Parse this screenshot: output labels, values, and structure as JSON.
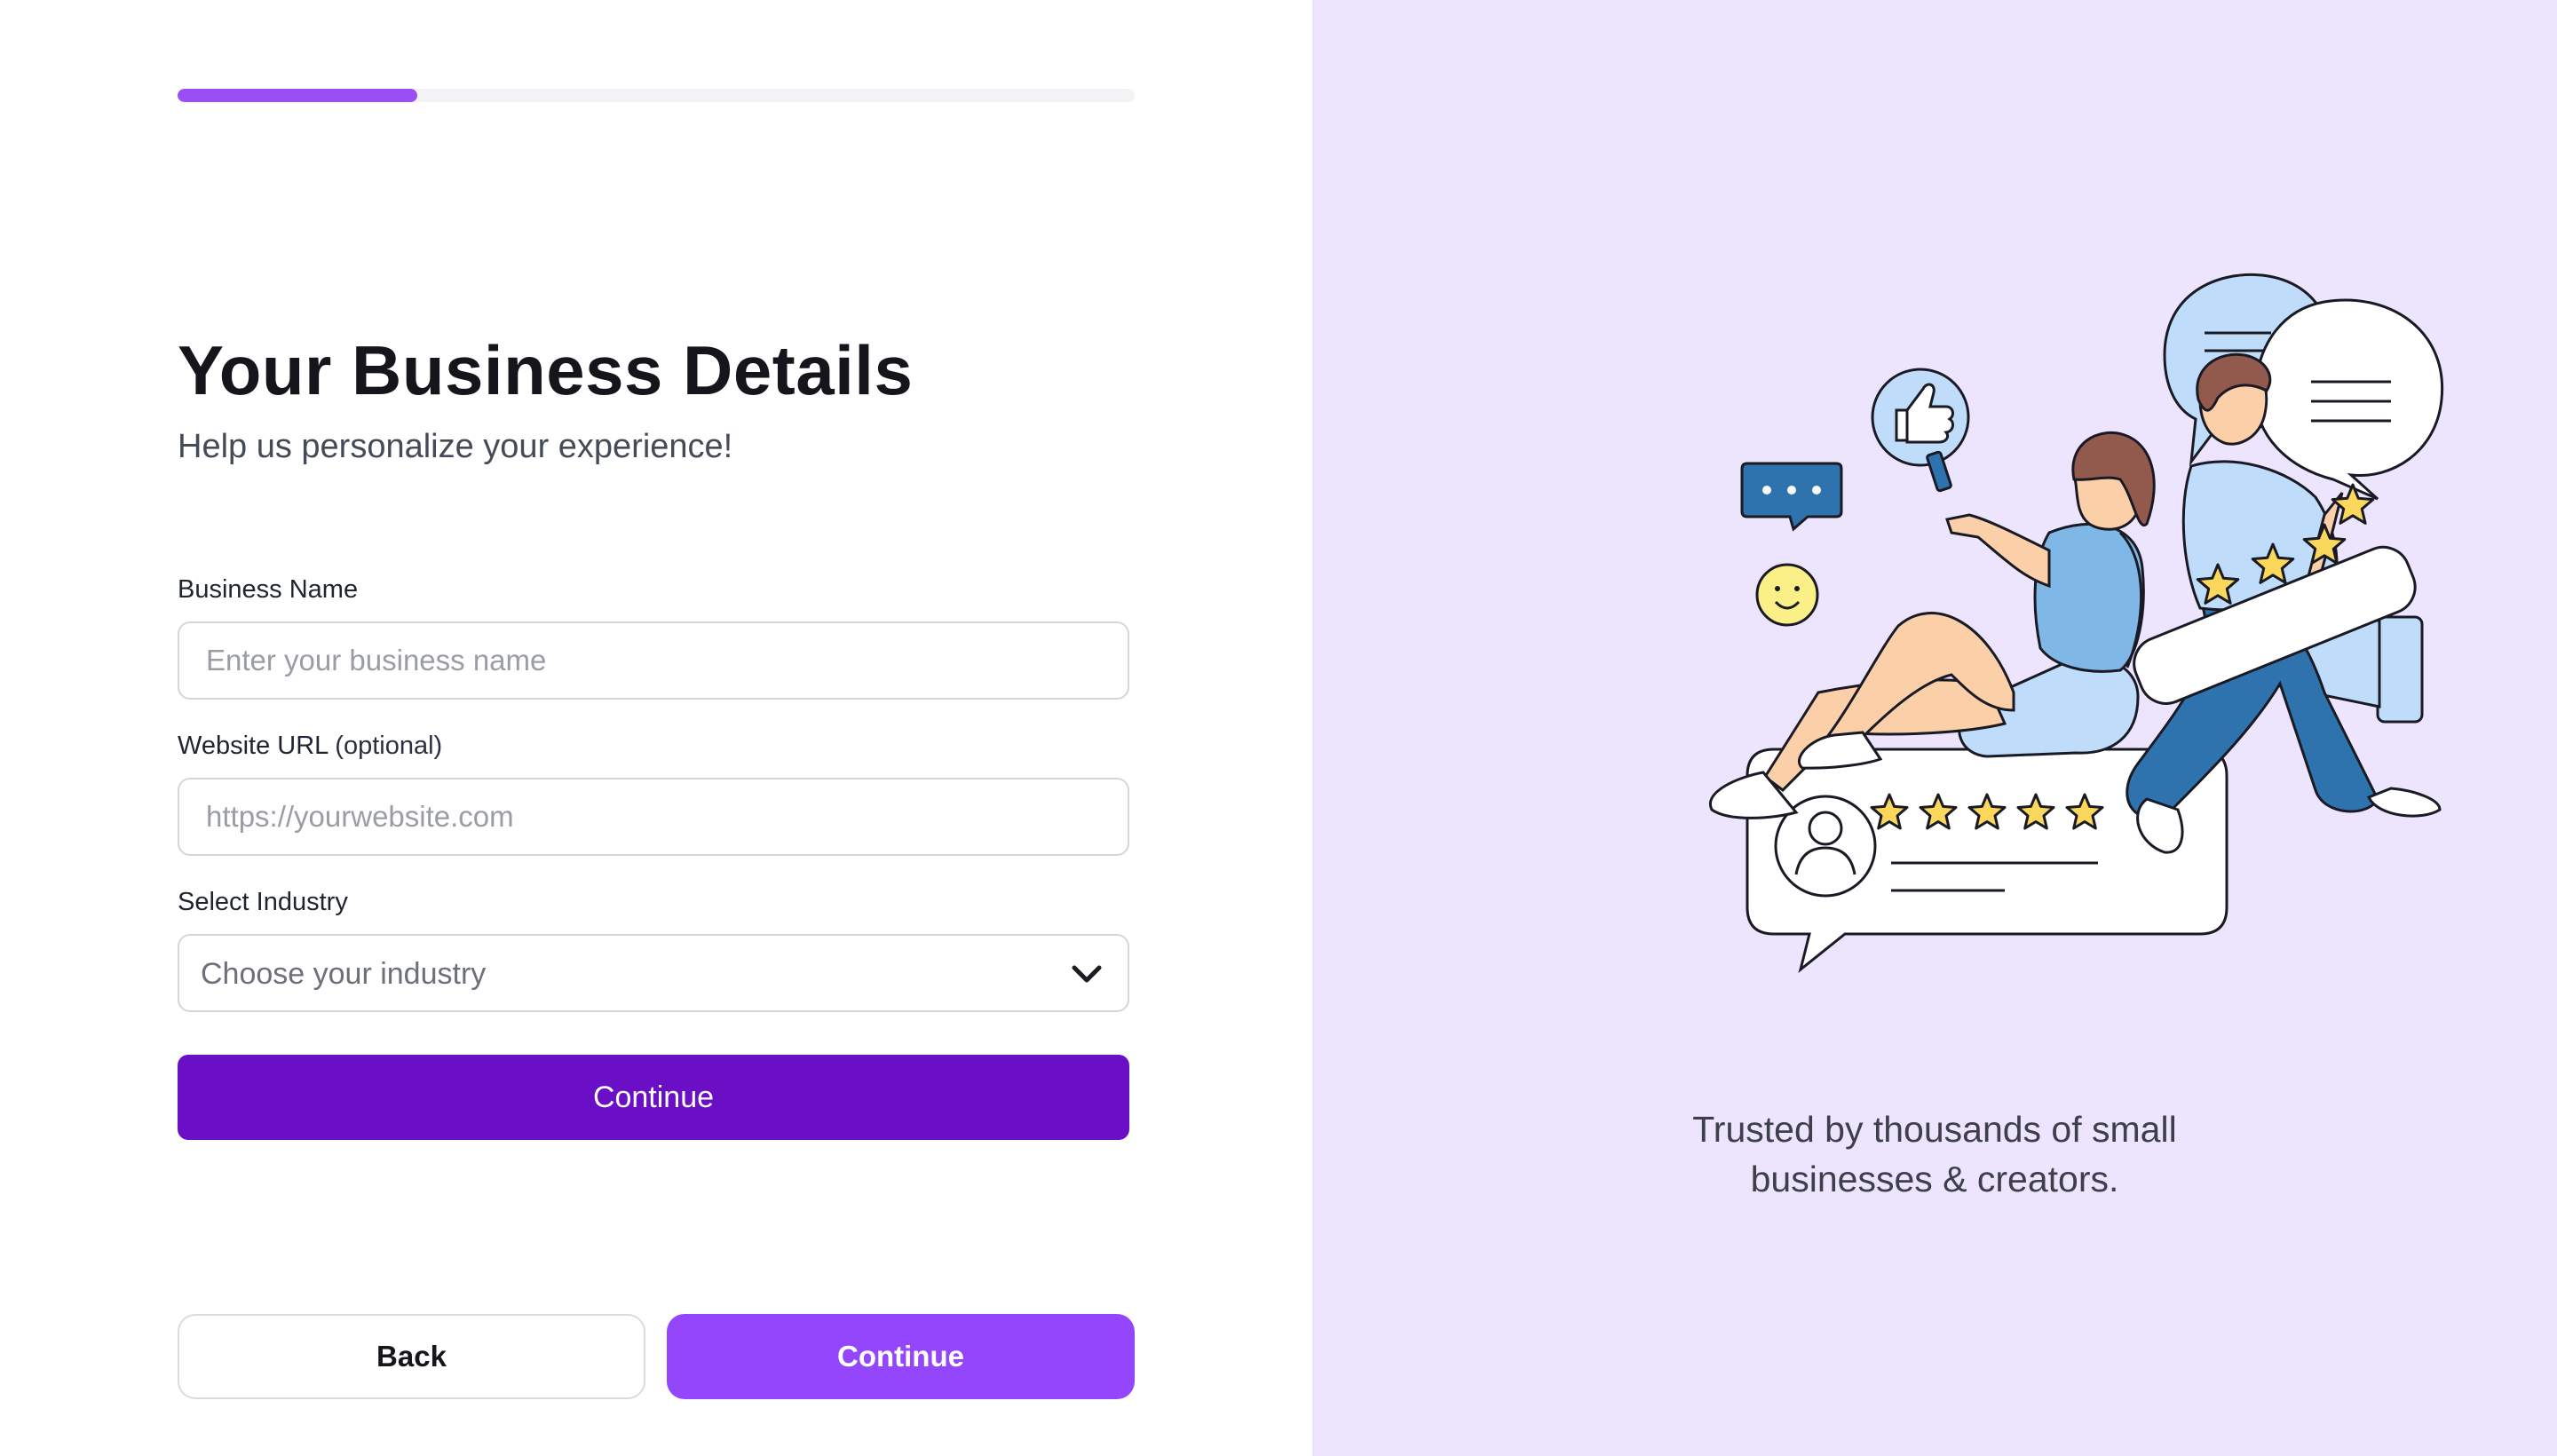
{
  "progress": {
    "value": 0.25,
    "fill_color": "#9b4df6"
  },
  "header": {
    "title": "Your Business Details",
    "subtitle": "Help us personalize your experience!"
  },
  "form": {
    "business_name": {
      "label": "Business Name",
      "placeholder": "Enter your business name",
      "value": ""
    },
    "website": {
      "label": "Website URL",
      "label_suffix": "(optional)",
      "placeholder": "https://yourwebsite.com",
      "value": ""
    },
    "industry": {
      "label": "Select Industry",
      "selected": "Choose your industry"
    },
    "continue_label": "Continue"
  },
  "footer": {
    "back_label": "Back",
    "continue_label": "Continue"
  },
  "side_panel": {
    "tagline_line1": "Trusted by thousands of small",
    "tagline_line2": "businesses & creators.",
    "rating_stars": 5,
    "background": "#ede5fe"
  },
  "colors": {
    "primary": "#6a0fc6",
    "accent": "#9346fb",
    "text": "#15151c"
  }
}
